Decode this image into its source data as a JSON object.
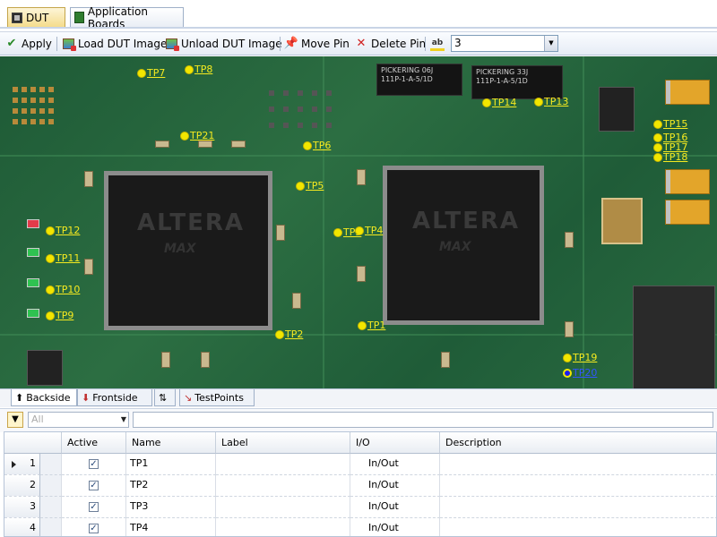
{
  "tabs": {
    "dut": "DUT",
    "boards": "Application Boards"
  },
  "toolbar": {
    "apply": "Apply",
    "load": "Load DUT Image",
    "unload": "Unload DUT Image",
    "move": "Move Pin",
    "delete": "Delete Pin",
    "combo_value": "3"
  },
  "board": {
    "relay1": [
      "PICKERING 06J",
      "111P-1-A-5/1D"
    ],
    "relay2": [
      "PICKERING 33J",
      "111P-1-A-5/1D"
    ],
    "fpga_brand": "ALTERA",
    "fpga_model": "MAX",
    "testpoints": [
      "TP7",
      "TP8",
      "TP14",
      "TP13",
      "TP15",
      "TP16",
      "TP17",
      "TP18",
      "TP21",
      "TP6",
      "TP5",
      "TP12",
      "TP11",
      "TP10",
      "TP9",
      "TP3",
      "TP4",
      "TP1",
      "TP2",
      "TP19",
      "TP20"
    ]
  },
  "view_tabs": {
    "backside": "Backside",
    "frontside": "Frontside",
    "testpoints": "TestPoints"
  },
  "filter": {
    "placeholder": "All"
  },
  "grid": {
    "columns": [
      "Active",
      "Name",
      "Label",
      "I/O",
      "Description"
    ],
    "rows": [
      {
        "num": "1",
        "active": true,
        "name": "TP1",
        "label": "",
        "io": "In/Out",
        "description": ""
      },
      {
        "num": "2",
        "active": true,
        "name": "TP2",
        "label": "",
        "io": "In/Out",
        "description": ""
      },
      {
        "num": "3",
        "active": true,
        "name": "TP3",
        "label": "",
        "io": "In/Out",
        "description": ""
      },
      {
        "num": "4",
        "active": true,
        "name": "TP4",
        "label": "",
        "io": "In/Out",
        "description": ""
      }
    ]
  }
}
